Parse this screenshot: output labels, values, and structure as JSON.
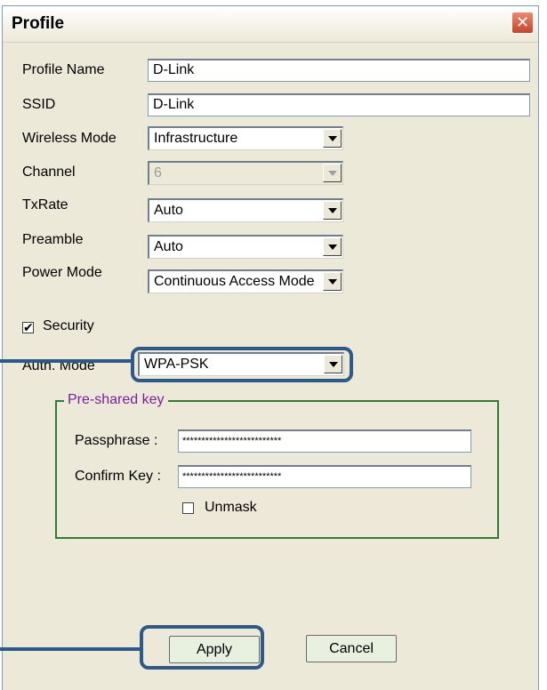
{
  "window": {
    "title": "Profile",
    "close_glyph": "✕"
  },
  "fields": {
    "profile_name": {
      "label": "Profile Name",
      "value": "D-Link"
    },
    "ssid": {
      "label": "SSID",
      "value": "D-Link"
    },
    "wireless_mode": {
      "label": "Wireless Mode",
      "value": "Infrastructure"
    },
    "channel": {
      "label": "Channel",
      "value": "6"
    },
    "txrate": {
      "label": "TxRate",
      "value": "Auto"
    },
    "preamble": {
      "label": "Preamble",
      "value": "Auto"
    },
    "power_mode": {
      "label": "Power Mode",
      "value": "Continuous Access Mode"
    }
  },
  "security": {
    "label": "Security",
    "checked_glyph": "✔",
    "auth_mode_label": "Auth. Mode",
    "auth_mode_value": "WPA-PSK"
  },
  "preshared": {
    "title": "Pre-shared key",
    "passphrase_label": "Passphrase :",
    "passphrase_value": "**************************",
    "confirm_label": "Confirm Key :",
    "confirm_value": "**************************",
    "unmask_label": "Unmask"
  },
  "buttons": {
    "apply": "Apply",
    "cancel": "Cancel"
  },
  "colors": {
    "callout": "#2e5a8a",
    "group_border": "#2e7d32",
    "group_title": "#7b1fa2"
  }
}
